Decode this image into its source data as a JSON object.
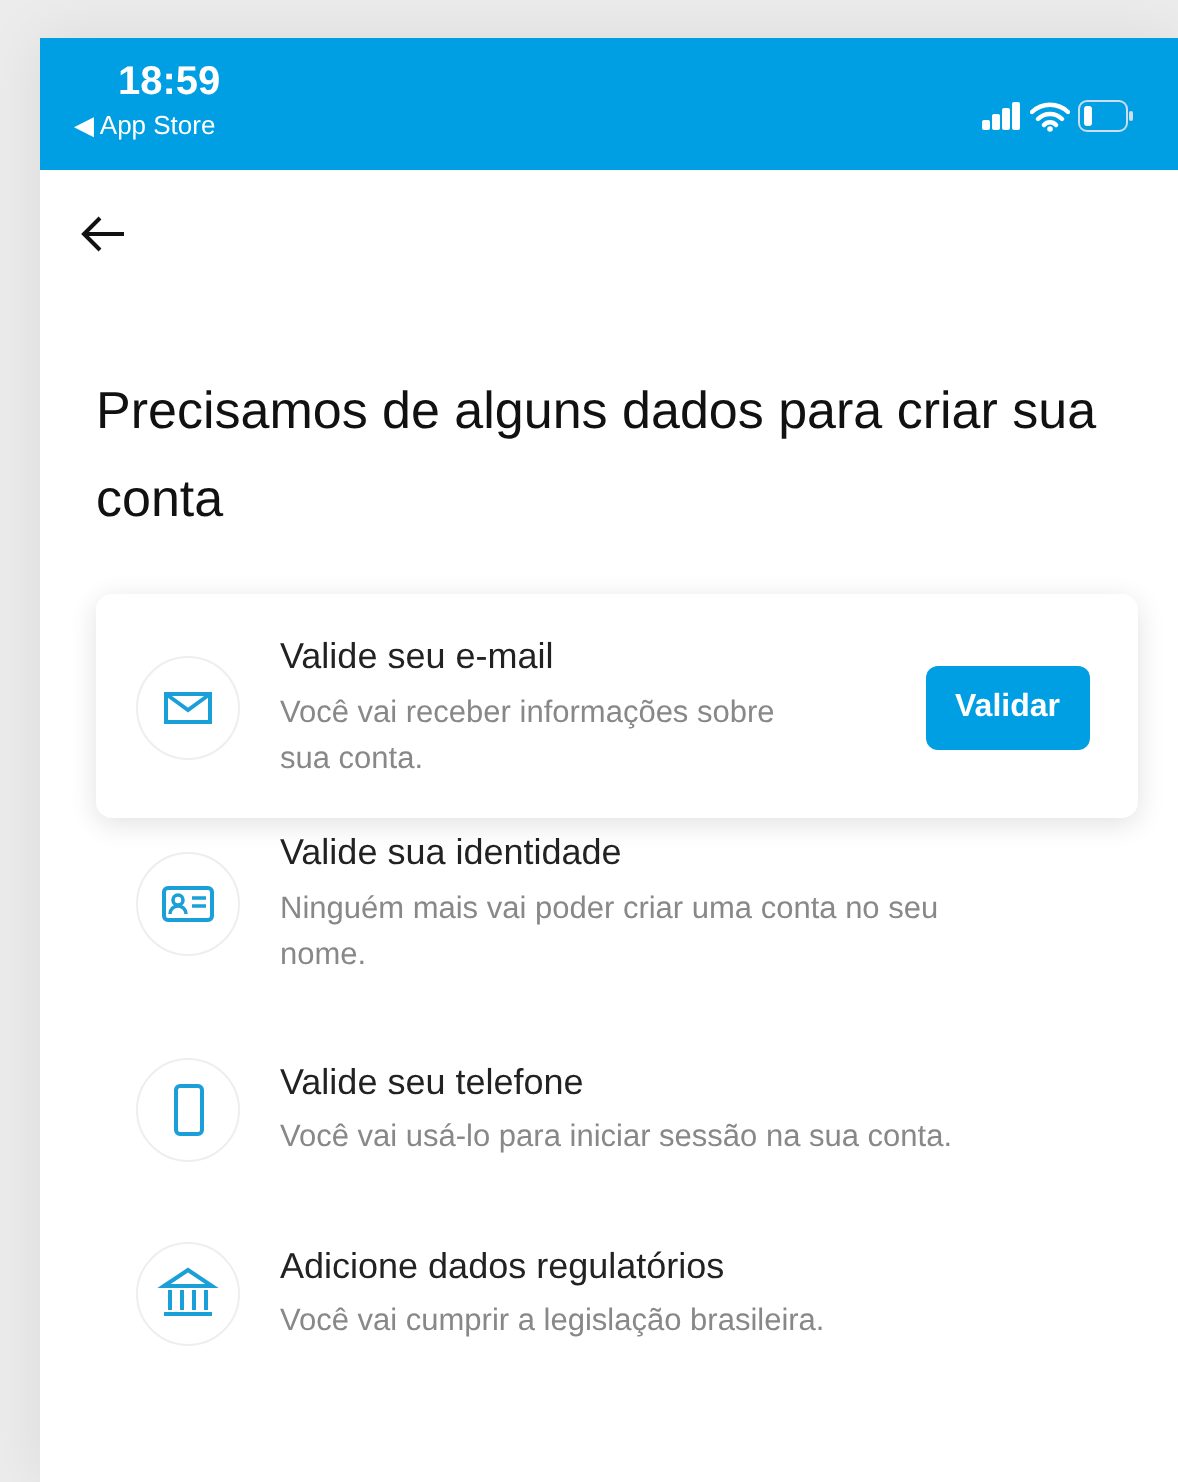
{
  "status_bar": {
    "time": "18:59",
    "back_app": "◀ App Store"
  },
  "title": "Precisamos de alguns dados para criar sua conta",
  "steps": [
    {
      "kind": "envelope",
      "title": "Valide seu e-mail",
      "description": "Você vai receber informações sobre sua conta.",
      "highlighted": true,
      "button": "Validar"
    },
    {
      "kind": "id-card",
      "title": "Valide sua identidade",
      "description": "Ninguém mais vai poder criar uma conta no seu nome.",
      "highlighted": false
    },
    {
      "kind": "phone",
      "title": "Valide seu telefone",
      "description": "Você vai usá-lo para iniciar sessão na sua conta.",
      "highlighted": false
    },
    {
      "kind": "bank",
      "title": "Adicione dados regulatórios",
      "description": "Você vai cumprir a legislação brasileira.",
      "highlighted": false
    }
  ]
}
